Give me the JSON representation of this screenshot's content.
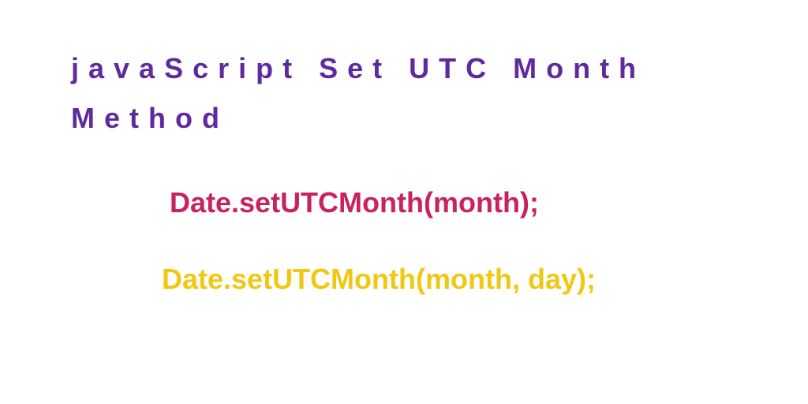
{
  "title": "javaScript Set UTC Month Method",
  "code_example_1": "Date.setUTCMonth(month);",
  "code_example_2": "Date.setUTCMonth(month, day);"
}
